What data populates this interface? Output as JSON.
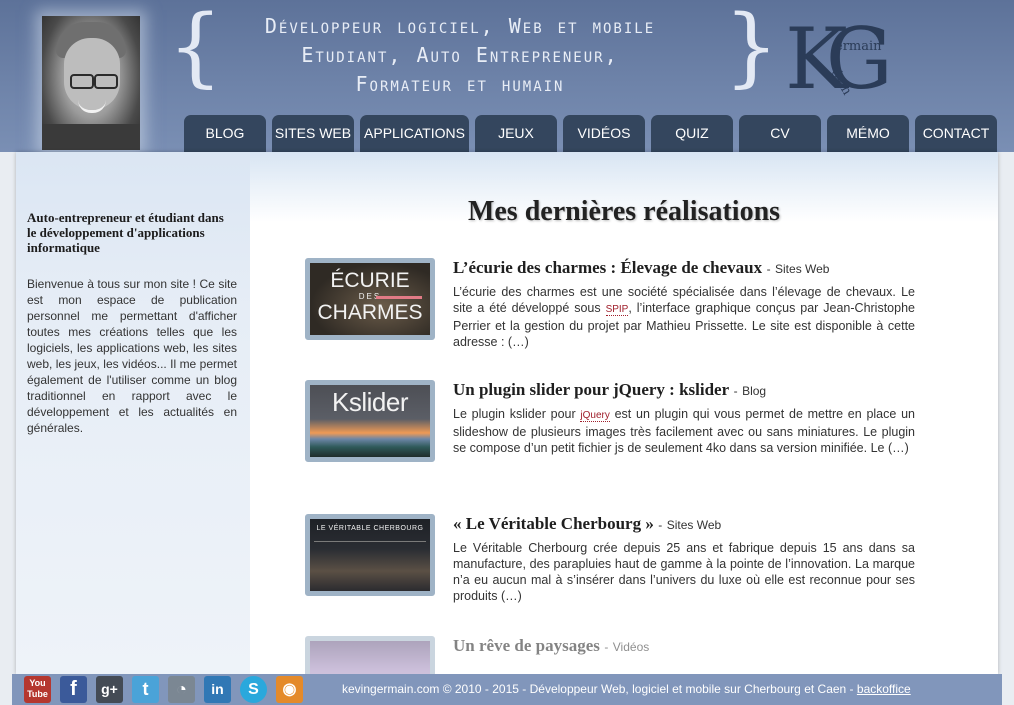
{
  "header": {
    "tagline": [
      "Développeur logiciel, Web et mobile",
      "Etudiant, Auto Entrepreneur,",
      "Formateur et humain"
    ],
    "logo": {
      "letters_big": "KG",
      "letters_small_top": "ermain",
      "letters_small_bottom": "évin"
    }
  },
  "nav": {
    "items": [
      "Blog",
      "Sites Web",
      "Applications",
      "Jeux",
      "Vidéos",
      "Quiz",
      "CV",
      "Mémo",
      "Contact"
    ]
  },
  "sidebar": {
    "title": "Auto-entrepreneur et étudiant dans le développement d'applications informatique",
    "text": "Bienvenue à tous sur mon site ! Ce site est mon espace de publication personnel me permettant d'afficher toutes mes créations telles que les logiciels, les applications web, les sites web, les jeux, les vidéos... Il me permet également de l'utiliser comme un blog traditionnel en rapport avec le développement et les actualités en générales."
  },
  "main": {
    "heading": "Mes dernières réalisations",
    "articles": [
      {
        "title": "L’écurie des charmes : Élevage de chevaux",
        "separator": "-",
        "category": "Sites Web",
        "text_before": "L’écurie des charmes est une société spécialisée dans l’élevage de chevaux. Le site a été développé sous",
        "term": "SPIP",
        "text_after": ", l’interface graphique conçus par Jean-Christophe Perrier et la gestion du projet par Mathieu Prissette. Le site est disponible à cette adresse :",
        "more": "(…)",
        "thumb_lines": [
          "ÉCURIE",
          "DES",
          "CHARMES"
        ]
      },
      {
        "title": "Un plugin slider pour jQuery : kslider",
        "separator": "-",
        "category": "Blog",
        "text_before": "Le plugin kslider pour",
        "term": "jQuery",
        "text_after": " est un plugin qui vous permet de mettre en place un slideshow de plusieurs images très facilement avec ou sans miniatures. Le plugin se compose d’un petit fichier js de seulement 4ko dans sa version minifiée. Le",
        "more": "(…)",
        "thumb_lines": [
          "Kslider"
        ]
      },
      {
        "title": "« Le Véritable Cherbourg »",
        "separator": "-",
        "category": "Sites Web",
        "text_before": "Le Véritable Cherbourg crée depuis 25 ans et fabrique depuis 15 ans dans sa manufacture, des parapluies haut de gamme à la pointe de l’innovation. La marque n’a eu aucun mal à s’insérer dans l’univers du luxe où elle est reconnue pour ses produits",
        "term": "",
        "text_after": "",
        "more": "(…)",
        "thumb_lines": [
          "LE VÉRITABLE CHERBOURG"
        ]
      },
      {
        "title": "Un rêve de paysages",
        "separator": "-",
        "category": "Vidéos",
        "text_before": "",
        "term": "",
        "text_after": "",
        "more": "",
        "thumb_lines": []
      }
    ]
  },
  "footer": {
    "social": [
      {
        "icon": "youtube-icon",
        "label": "You Tube",
        "color": "#b5372f"
      },
      {
        "icon": "facebook-icon",
        "label": "f",
        "color": "#3b5a9a"
      },
      {
        "icon": "google-plus-icon",
        "label": "g+",
        "color": "#444b55"
      },
      {
        "icon": "twitter-icon",
        "label": "t",
        "color": "#4aa3d8"
      },
      {
        "icon": "viadeo-icon",
        "label": "◔",
        "color": "#7b8793"
      },
      {
        "icon": "linkedin-icon",
        "label": "in",
        "color": "#3178b5"
      },
      {
        "icon": "skype-icon",
        "label": "S",
        "color": "#2aa8dc"
      },
      {
        "icon": "rss-icon",
        "label": "◉",
        "color": "#e48a2a"
      }
    ],
    "copyright": "kevingermain.com © 2010 - 2015 - Développeur Web, logiciel et mobile sur Cherbourg et Caen -",
    "backoffice": "backoffice"
  },
  "colors": {
    "header_bg": "#6e83a9",
    "nav_tab": "#34465e",
    "footer_bg": "#8196bb",
    "thumb_border": "#9fb3c6",
    "term_color": "#a0202c"
  }
}
